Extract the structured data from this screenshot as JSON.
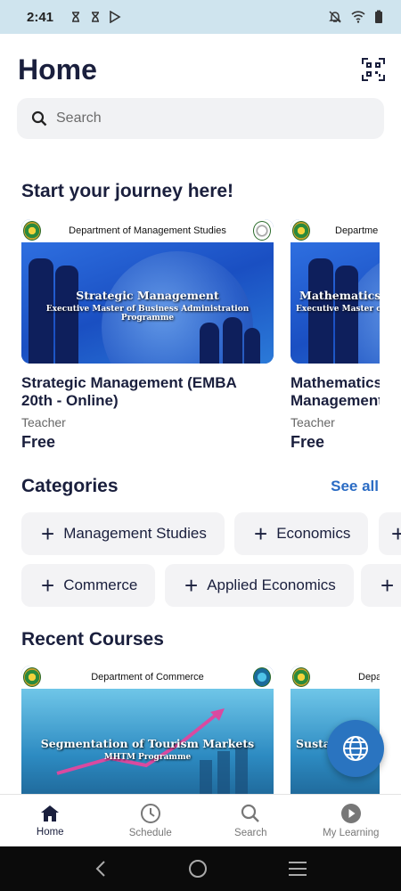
{
  "status": {
    "time": "2:41"
  },
  "header": {
    "title": "Home"
  },
  "search": {
    "placeholder": "Search"
  },
  "sections": {
    "journey": "Start your journey here!",
    "categories": "Categories",
    "see_all": "See all",
    "recent": "Recent Courses"
  },
  "journey_courses": [
    {
      "dept": "Department of Management Studies",
      "thumb_title": "Strategic Management",
      "thumb_subtitle": "Executive Master of Business Administration Programme",
      "title": "Strategic Management (EMBA 20th - Online)",
      "teacher": "Teacher",
      "price": "Free"
    },
    {
      "dept": "Departme",
      "thumb_title": "Mathematics &",
      "thumb_subtitle": "Executive Master of",
      "title": "Mathematics Management",
      "teacher": "Teacher",
      "price": "Free"
    }
  ],
  "categories": [
    {
      "label": "Management Studies"
    },
    {
      "label": "Economics"
    },
    {
      "label": "Commerce"
    },
    {
      "label": "Applied Economics"
    }
  ],
  "recent_courses": [
    {
      "dept": "Department of Commerce",
      "thumb_title": "Segmentation of Tourism Markets",
      "thumb_subtitle": "MHTM Programme"
    },
    {
      "dept": "Depa",
      "thumb_title": "Susta"
    }
  ],
  "nav": {
    "home": "Home",
    "schedule": "Schedule",
    "search": "Search",
    "learning": "My Learning"
  },
  "colors": {
    "accent": "#2a74c0",
    "link": "#2b6cc4",
    "status_bar": "#cfe4ee",
    "title": "#1a1f3d"
  }
}
